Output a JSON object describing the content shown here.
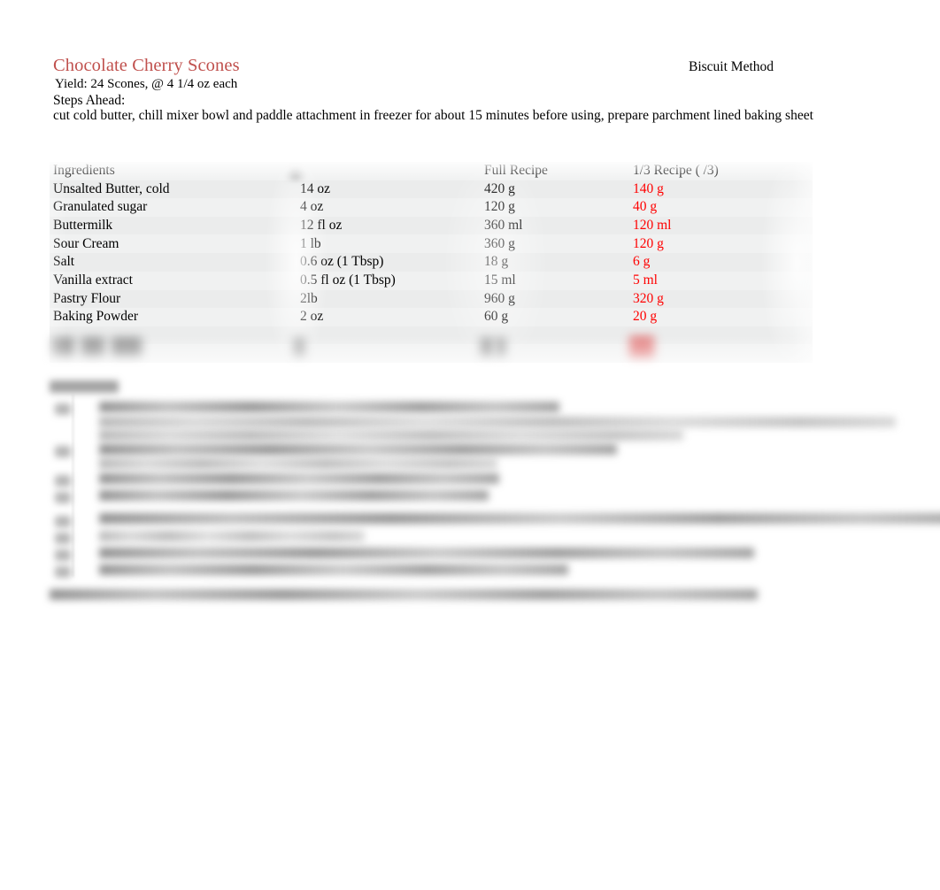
{
  "document": {
    "title": "Chocolate Cherry Scones",
    "method_label": "Biscuit Method",
    "title_color": "#c0504d",
    "yield_line": "  Yield: 24 Scones, @ 4 1/4 oz each",
    "steps_ahead_label": "Steps Ahead:",
    "steps_ahead_text": "cut cold butter, chill mixer bowl and paddle attachment in freezer for about 15 minutes before using, prepare parchment lined baking sheet"
  },
  "table": {
    "headers": {
      "ingredients": "Ingredients",
      "amount": "",
      "full_recipe": "Full Recipe",
      "third_recipe": "1/3 Recipe ( /3)"
    },
    "third_recipe_color": "#ff0000",
    "rows": [
      {
        "ingredient": "Unsalted Butter, cold",
        "amount": "14 oz",
        "full": "420 g",
        "third": "140 g"
      },
      {
        "ingredient": "Granulated sugar",
        "amount": "4 oz",
        "full": "120 g",
        "third": "40 g"
      },
      {
        "ingredient": "Buttermilk",
        "amount": "12 fl oz",
        "full": "360 ml",
        "third": "120 ml"
      },
      {
        "ingredient": "Sour Cream",
        "amount": "1 lb",
        "full": "360 g",
        "third": "120 g"
      },
      {
        "ingredient": "Salt",
        "amount": "0.6 oz (1 Tbsp)",
        "full": "18 g",
        "third": "6 g"
      },
      {
        "ingredient": "Vanilla extract",
        "amount": "0.5 fl oz (1 Tbsp)",
        "full": "15 ml",
        "third": "5 ml"
      },
      {
        "ingredient": "Pastry Flour",
        "amount": "2lb",
        "full": "960 g",
        "third": "320 g"
      },
      {
        "ingredient": "Baking Powder",
        "amount": "2 oz",
        "full": "60 g",
        "third": " 20 g"
      }
    ],
    "redacted_last_row": {
      "ingredient": "",
      "amount": "",
      "full": "",
      "third": ""
    }
  },
  "method_section": {
    "label": "",
    "steps": []
  }
}
